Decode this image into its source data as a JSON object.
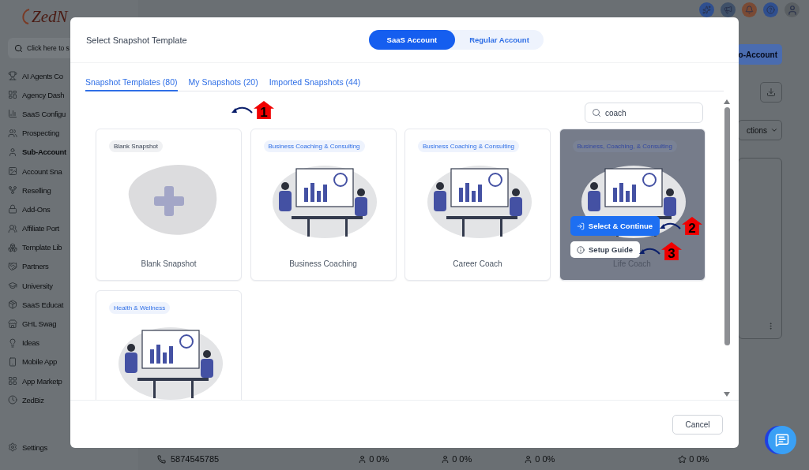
{
  "background": {
    "logo": "ZedN",
    "search_hint": "Click here to s",
    "sidebar": {
      "items": [
        {
          "label": "AI Agents Co",
          "selected": false
        },
        {
          "label": "Agency Dash",
          "selected": false
        },
        {
          "label": "SaaS Configu",
          "selected": false
        },
        {
          "label": "Prospecting",
          "selected": false
        },
        {
          "label": "Sub-Account",
          "selected": true
        },
        {
          "label": "Account Sna",
          "selected": false
        },
        {
          "label": "Reselling",
          "selected": false
        },
        {
          "label": "Add-Ons",
          "selected": false
        },
        {
          "label": "Affiliate Port",
          "selected": false
        },
        {
          "label": "Template Lib",
          "selected": false
        },
        {
          "label": "Partners",
          "selected": false
        },
        {
          "label": "University",
          "selected": false
        },
        {
          "label": "SaaS Educat",
          "selected": false
        },
        {
          "label": "GHL Swag",
          "selected": false
        },
        {
          "label": "Ideas",
          "selected": false
        },
        {
          "label": "Mobile App",
          "selected": false
        },
        {
          "label": "App Marketp",
          "selected": false
        },
        {
          "label": "ZedBiz",
          "selected": false
        }
      ],
      "settings": "Settings"
    },
    "header_button": "o-Account",
    "actions_dropdown": "ctions",
    "contact": {
      "phone": "5874545785",
      "stats": [
        {
          "count": "0",
          "percent": "0%"
        },
        {
          "count": "0",
          "percent": "0%"
        },
        {
          "count": "0",
          "percent": "0%"
        },
        {
          "count": "0",
          "percent": "0%"
        }
      ]
    }
  },
  "dialog": {
    "title": "Select Snapshot Template",
    "account_types": [
      {
        "label": "SaaS Account",
        "selected": true
      },
      {
        "label": "Regular Account",
        "selected": false
      }
    ],
    "tabs": [
      {
        "label": "Snapshot Templates (80)",
        "selected": true
      },
      {
        "label": "My Snapshots (20)",
        "selected": false
      },
      {
        "label": "Imported Snapshots (44)",
        "selected": false
      }
    ],
    "search": {
      "value": "coach"
    },
    "cards": [
      {
        "kind": "blank",
        "tag": "Blank Snapshot",
        "title": "Blank Snapshot",
        "hovered": false
      },
      {
        "kind": "template",
        "tag": "Business Coaching & Consulting",
        "title": "Business Coaching",
        "hovered": false
      },
      {
        "kind": "template",
        "tag": "Business Coaching & Consulting",
        "title": "Career Coach",
        "hovered": false
      },
      {
        "kind": "template",
        "tag": "Business, Coaching, & Consulting",
        "title": "Life Coach",
        "hovered": true,
        "actions": [
          "Select & Continue",
          "Setup Guide"
        ]
      },
      {
        "kind": "template",
        "tag": "Health & Wellness",
        "hovered": false
      }
    ],
    "cancel_button": "Cancel"
  },
  "annotations": [
    {
      "number": "1"
    },
    {
      "number": "2"
    },
    {
      "number": "3"
    }
  ]
}
